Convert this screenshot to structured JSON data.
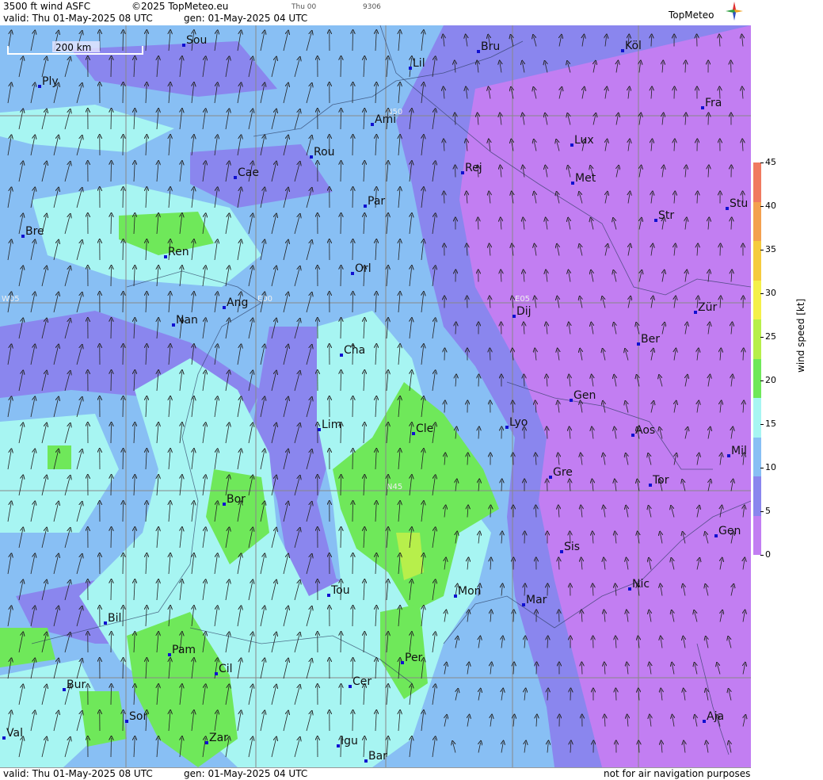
{
  "header": {
    "title": "3500 ft wind ASFC",
    "copyright": "©2025 TopMeteo.eu",
    "valid": "valid:  Thu  01-May-2025  08 UTC",
    "gen": "gen: 01-May-2025 04 UTC",
    "run_tag": "Thu 00",
    "code": "9306",
    "logo": "TopMeteo"
  },
  "footer": {
    "valid": "valid:  Thu  01-May-2025  08 UTC",
    "gen": "gen: 01-May-2025 04 UTC",
    "disclaimer": "not for air navigation purposes"
  },
  "scale_bar": "200 km",
  "grid_labels": [
    "N50",
    "N45",
    "W05",
    "E00",
    "E05"
  ],
  "legend": {
    "unit": "wind speed [kt]",
    "ticks": [
      "45",
      "40",
      "35",
      "30",
      "25",
      "20",
      "15",
      "10",
      "5",
      "0"
    ],
    "colors": [
      "#f07a60",
      "#f3a14f",
      "#f5cb3f",
      "#f4f04a",
      "#b7ef4b",
      "#6fe85a",
      "#a7f5f2",
      "#88bff4",
      "#8a86ee",
      "#c27ef2"
    ]
  },
  "cities": [
    {
      "name": "Sou"
    },
    {
      "name": "Bru"
    },
    {
      "name": "Köl"
    },
    {
      "name": "Ply"
    },
    {
      "name": "Lil"
    },
    {
      "name": "Ami"
    },
    {
      "name": "Fra"
    },
    {
      "name": "Lux"
    },
    {
      "name": "Rou"
    },
    {
      "name": "Rej"
    },
    {
      "name": "Cae"
    },
    {
      "name": "Met"
    },
    {
      "name": "Par"
    },
    {
      "name": "Str"
    },
    {
      "name": "Stu"
    },
    {
      "name": "Bre"
    },
    {
      "name": "Ren"
    },
    {
      "name": "Orl"
    },
    {
      "name": "Ang"
    },
    {
      "name": "Dij"
    },
    {
      "name": "Zür"
    },
    {
      "name": "Nan"
    },
    {
      "name": "Ber"
    },
    {
      "name": "Cha"
    },
    {
      "name": "Gen"
    },
    {
      "name": "Lim"
    },
    {
      "name": "Cle"
    },
    {
      "name": "Lyo"
    },
    {
      "name": "Aos"
    },
    {
      "name": "Mil"
    },
    {
      "name": "Gre"
    },
    {
      "name": "Tor"
    },
    {
      "name": "Bor"
    },
    {
      "name": "Sis"
    },
    {
      "name": "Gen"
    },
    {
      "name": "Tou"
    },
    {
      "name": "Mon"
    },
    {
      "name": "Nic"
    },
    {
      "name": "Mar"
    },
    {
      "name": "Bil"
    },
    {
      "name": "Pam"
    },
    {
      "name": "Per"
    },
    {
      "name": "Cil"
    },
    {
      "name": "Bur"
    },
    {
      "name": "Cer"
    },
    {
      "name": "Sor"
    },
    {
      "name": "Aja"
    },
    {
      "name": "Val"
    },
    {
      "name": "Zar"
    },
    {
      "name": "Igu"
    },
    {
      "name": "Bar"
    }
  ]
}
